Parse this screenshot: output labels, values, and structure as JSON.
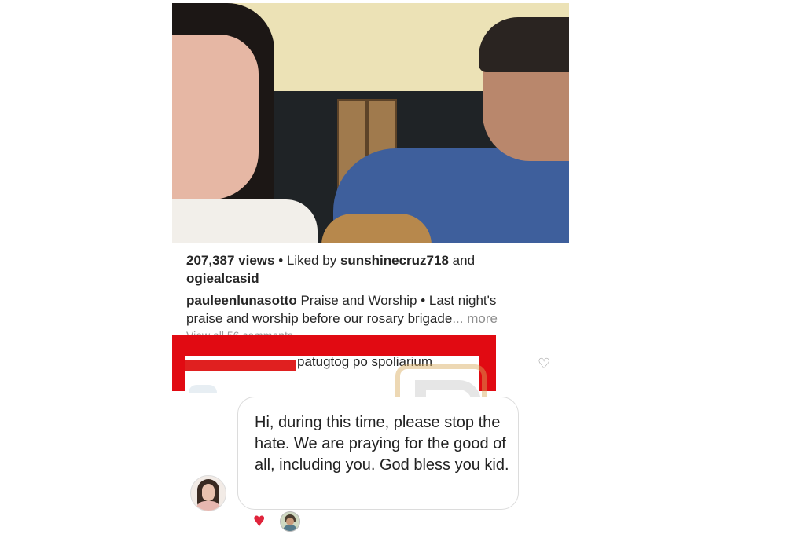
{
  "post": {
    "views": "207,387 views",
    "separator": "•",
    "liked_prefix": "Liked by",
    "liker1": "sunshinecruz718",
    "and_word": "and",
    "liker2": "ogiealcasid",
    "author": "pauleenlunasotto",
    "caption_line1": "Praise and Worship • Last night's",
    "caption_line2": "praise and worship before our rosary brigade",
    "ellipsis": "...",
    "more": "more",
    "view_comments": "View all 56 comments"
  },
  "comment": {
    "text": "patugtog po spoliarium",
    "redaction_color": "#e02020"
  },
  "reply": {
    "text": "Hi, during this time, please stop the hate. We are praying for the good of all, including you. God bless you kid."
  },
  "icons": {
    "comment_like": "heart-outline-icon",
    "reaction": "heart-filled-icon"
  },
  "colors": {
    "highlight_box": "#e10a12",
    "heart": "#e0243b"
  }
}
